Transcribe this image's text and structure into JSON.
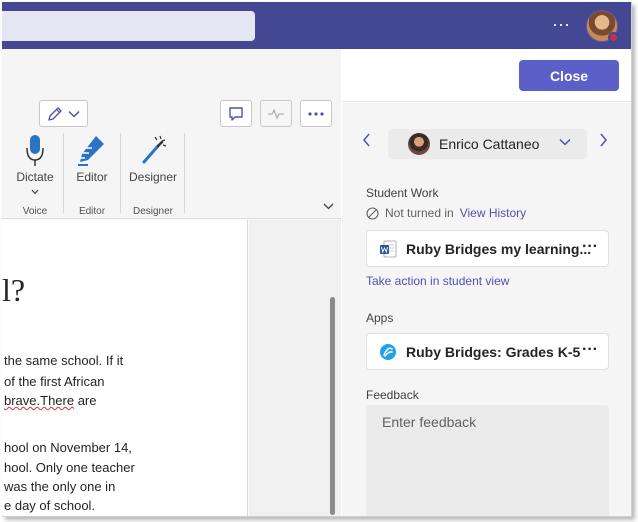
{
  "topbar": {
    "more_label": "···",
    "avatar_icon": "user-avatar-icon",
    "presence_color": "#c4314b"
  },
  "ribbon": {
    "groups": [
      {
        "button_label": "Dictate",
        "group_label": "Voice",
        "icon": "microphone-icon"
      },
      {
        "button_label": "Editor",
        "group_label": "Editor",
        "icon": "editor-pen-icon"
      },
      {
        "button_label": "Designer",
        "group_label": "Designer",
        "icon": "designer-wand-icon"
      }
    ]
  },
  "document": {
    "heading": "l?",
    "lines": [
      "the same school. If it",
      "of the first African",
      "brave.There are",
      "",
      "hool on November 14,",
      "hool. Only one teacher",
      "was the only one in",
      "e day of school."
    ],
    "line3_prefix": "",
    "line3_squiggle": "brave.There",
    "line3_rest": " are"
  },
  "panel": {
    "close_label": "Close",
    "student_name": "Enrico Cattaneo",
    "student_work_title": "Student Work",
    "status_text": "Not turned in",
    "view_history_label": "View History",
    "work_file_name": "Ruby Bridges my learning...",
    "take_action_label": "Take action in student view",
    "apps_title": "Apps",
    "app_name": "Ruby Bridges: Grades K-5",
    "feedback_title": "Feedback",
    "feedback_placeholder": "Enter feedback",
    "accent_color": "#5b5fc7",
    "brand_color": "#444791"
  }
}
